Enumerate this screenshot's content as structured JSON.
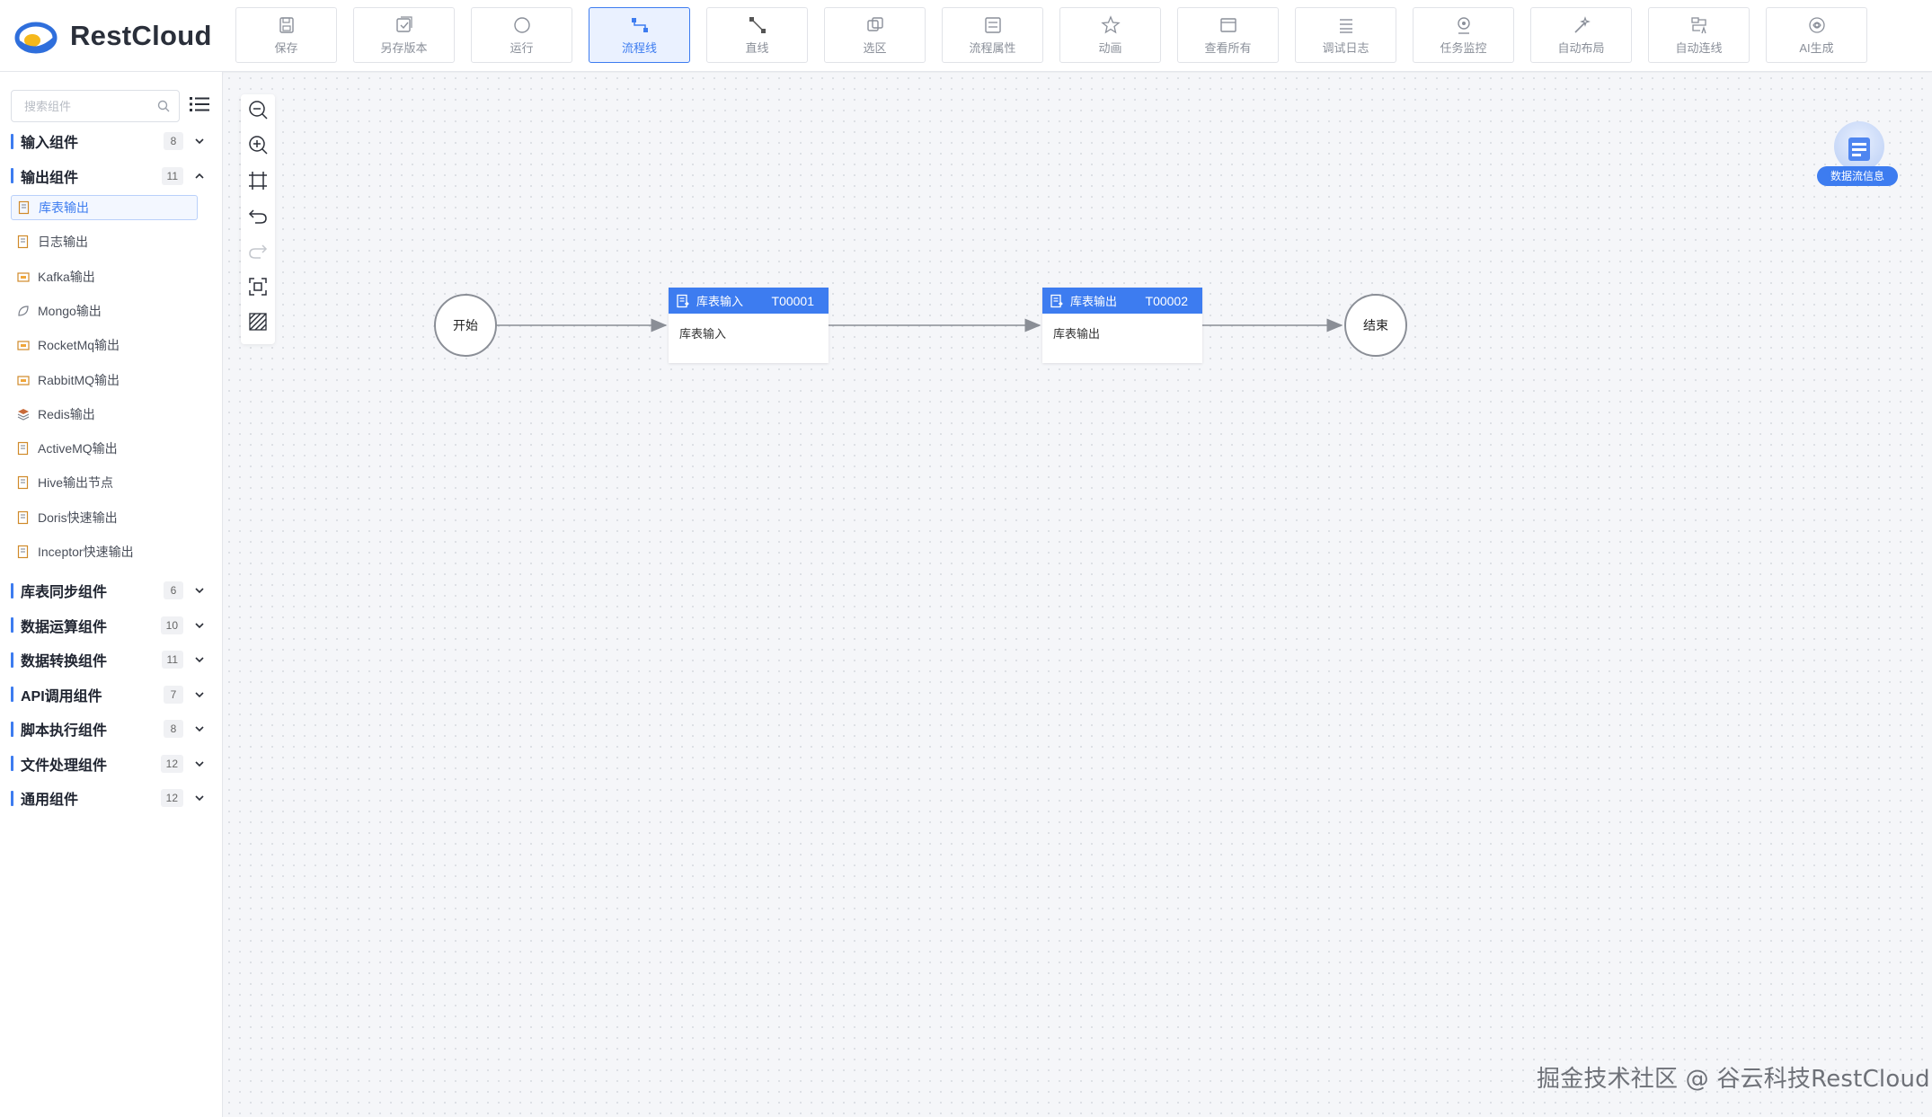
{
  "app": {
    "logo_text": "RestCloud"
  },
  "toolbar": [
    {
      "label": "保存",
      "icon": "save-icon"
    },
    {
      "label": "另存版本",
      "icon": "save-version-icon"
    },
    {
      "label": "运行",
      "icon": "run-icon"
    },
    {
      "label": "流程线",
      "icon": "flow-line-icon",
      "active": true
    },
    {
      "label": "直线",
      "icon": "straight-line-icon"
    },
    {
      "label": "选区",
      "icon": "selection-icon"
    },
    {
      "label": "流程属性",
      "icon": "flow-properties-icon"
    },
    {
      "label": "动画",
      "icon": "animation-icon"
    },
    {
      "label": "查看所有",
      "icon": "view-all-icon"
    },
    {
      "label": "调试日志",
      "icon": "debug-log-icon"
    },
    {
      "label": "任务监控",
      "icon": "task-monitor-icon"
    },
    {
      "label": "自动布局",
      "icon": "auto-layout-icon"
    },
    {
      "label": "自动连线",
      "icon": "auto-connect-icon"
    },
    {
      "label": "AI生成",
      "icon": "ai-generate-icon"
    }
  ],
  "sidebar": {
    "search_placeholder": "搜索组件",
    "categories": [
      {
        "name": "输入组件",
        "count": "8",
        "expanded": false
      },
      {
        "name": "输出组件",
        "count": "11",
        "expanded": true,
        "items": [
          "库表输出",
          "日志输出",
          "Kafka输出",
          "Mongo输出",
          "RocketMq输出",
          "RabbitMQ输出",
          "Redis输出",
          "ActiveMQ输出",
          "Hive输出节点",
          "Doris快速输出",
          "Inceptor快速输出"
        ],
        "selected": "库表输出"
      },
      {
        "name": "库表同步组件",
        "count": "6",
        "expanded": false
      },
      {
        "name": "数据运算组件",
        "count": "10",
        "expanded": false
      },
      {
        "name": "数据转换组件",
        "count": "11",
        "expanded": false
      },
      {
        "name": "API调用组件",
        "count": "7",
        "expanded": false
      },
      {
        "name": "脚本执行组件",
        "count": "8",
        "expanded": false
      },
      {
        "name": "文件处理组件",
        "count": "12",
        "expanded": false
      },
      {
        "name": "通用组件",
        "count": "12",
        "expanded": false
      }
    ]
  },
  "canvas": {
    "zoom_tools": [
      "zoom-out-icon",
      "zoom-in-icon",
      "fit-view-icon",
      "undo-icon",
      "redo-icon",
      "fullscreen-icon",
      "grid-toggle-icon"
    ],
    "start_node": {
      "label": "开始"
    },
    "end_node": {
      "label": "结束"
    },
    "tasks": [
      {
        "type": "库表输入",
        "id": "T00001",
        "name": "库表输入"
      },
      {
        "type": "库表输出",
        "id": "T00002",
        "name": "库表输出"
      }
    ],
    "flow_info_label": "数据流信息"
  },
  "colors": {
    "accent": "#3d7cf0",
    "node_border": "#8a8e96",
    "edge": "#8a8e96"
  },
  "watermark": "掘金技术社区 @ 谷云科技RestCloud"
}
